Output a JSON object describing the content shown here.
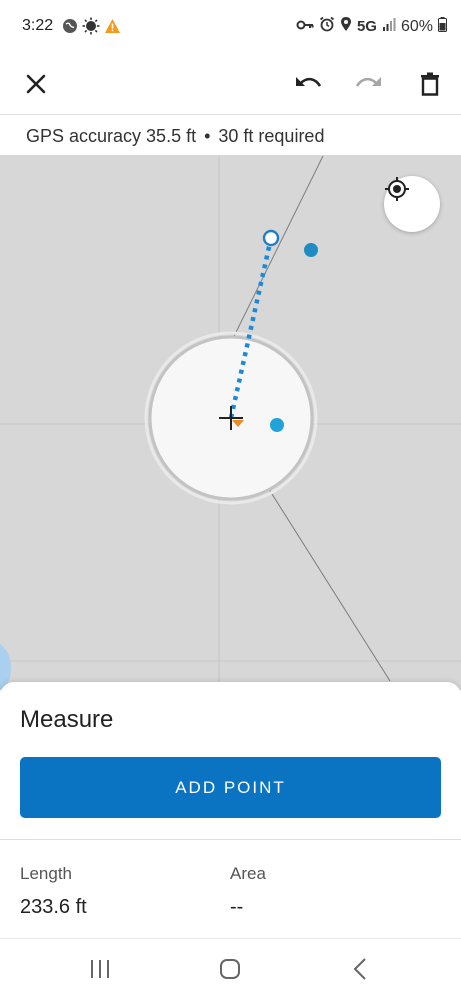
{
  "status_bar": {
    "time": "3:22",
    "left_icons": [
      "globe-icon",
      "sun-icon",
      "warning-icon"
    ],
    "right_icons": [
      "vpn-key-icon",
      "alarm-icon",
      "location-icon",
      "signal-icon",
      "battery-icon"
    ],
    "network": "5G",
    "battery": "60%"
  },
  "toolbar": {
    "close_icon": "close-icon",
    "undo_icon": "undo-icon",
    "redo_icon": "redo-icon",
    "delete_icon": "trash-icon"
  },
  "gps": {
    "accuracy": "GPS accuracy 35.5 ft",
    "separator": "•",
    "required": "30 ft required"
  },
  "map": {
    "locate_icon": "gps-target-icon",
    "colors": {
      "background": "#d7d7d7",
      "measure_line": "#1a8ad8",
      "point": "#1e8bc3",
      "gps_point": "#21a3d9",
      "heading": "#f08a24"
    }
  },
  "sheet": {
    "title": "Measure",
    "add_point_label": "ADD POINT",
    "length_label": "Length",
    "length_value": "233.6 ft",
    "area_label": "Area",
    "area_value": "--"
  },
  "nav": {
    "recents_icon": "recents-icon",
    "home_icon": "home-icon",
    "back_icon": "back-icon"
  },
  "colors": {
    "accent": "#0a74c3"
  }
}
